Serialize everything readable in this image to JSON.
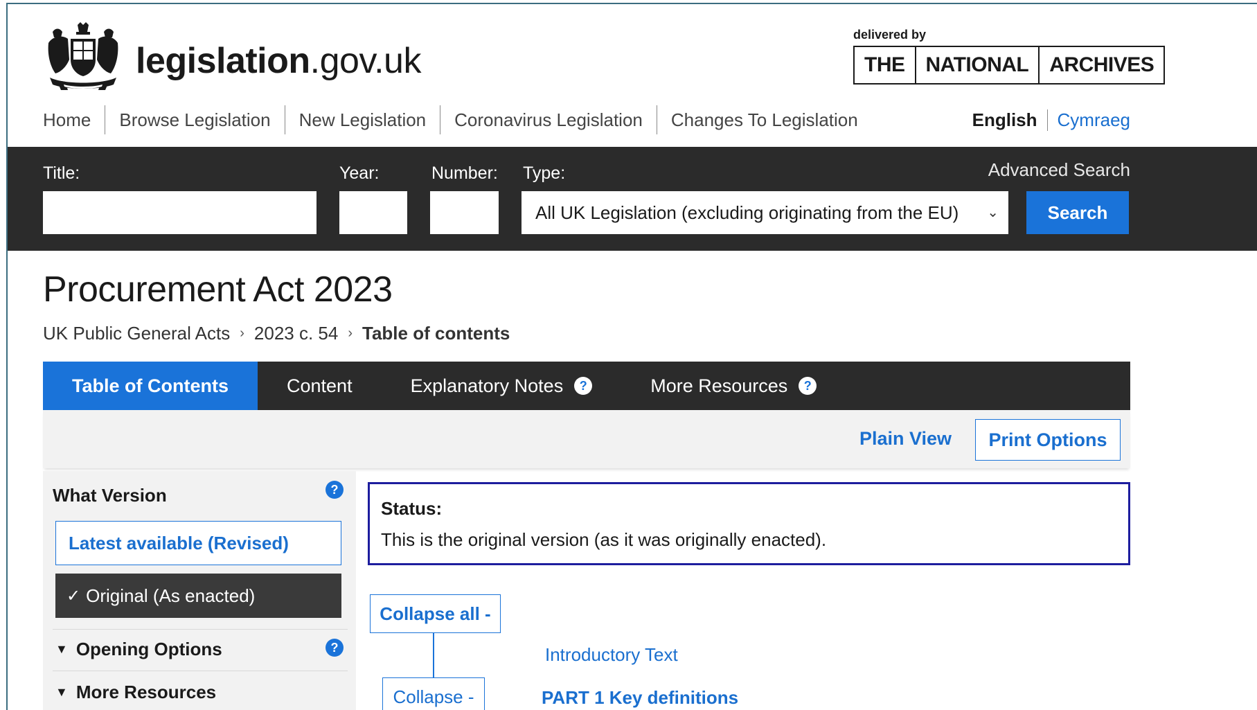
{
  "header": {
    "logo_bold": "legislation",
    "logo_light": ".gov.uk",
    "delivered_by": "delivered by",
    "tna": [
      "THE",
      "NATIONAL",
      "ARCHIVES"
    ]
  },
  "nav": {
    "items": [
      "Home",
      "Browse Legislation",
      "New Legislation",
      "Coronavirus Legislation",
      "Changes To Legislation"
    ],
    "lang_en": "English",
    "lang_cy": "Cymraeg"
  },
  "search": {
    "title_label": "Title:",
    "year_label": "Year:",
    "number_label": "Number:",
    "type_label": "Type:",
    "advanced": "Advanced Search",
    "type_value": "All UK Legislation (excluding originating from the EU)",
    "button": "Search"
  },
  "page": {
    "title": "Procurement Act 2023",
    "breadcrumb": [
      "UK Public General Acts",
      "2023 c. 54",
      "Table of contents"
    ]
  },
  "tabs": [
    {
      "label": "Table of Contents",
      "active": true,
      "help": false
    },
    {
      "label": "Content",
      "active": false,
      "help": false
    },
    {
      "label": "Explanatory Notes",
      "active": false,
      "help": true
    },
    {
      "label": "More Resources",
      "active": false,
      "help": true
    }
  ],
  "toolbar": {
    "plain_view": "Plain View",
    "print_options": "Print Options"
  },
  "sidebar": {
    "heading": "What Version",
    "latest": "Latest available (Revised)",
    "original": "Original (As enacted)",
    "opening_options": "Opening Options",
    "more_resources": "More Resources"
  },
  "status": {
    "label": "Status:",
    "text": "This is the original version (as it was originally enacted)."
  },
  "toc": {
    "collapse_all": "Collapse all -",
    "collapse": "Collapse -",
    "intro": "Introductory Text",
    "part1": "PART 1 Key definitions"
  },
  "colors": {
    "accent": "#1a73d9",
    "dark_bar": "#2b2b2b",
    "status_border": "#1d1d9e"
  },
  "icons": {
    "crest": "royal-coat-of-arms-icon",
    "help": "question-circle-icon",
    "check": "check-icon",
    "triangle": "triangle-down-icon",
    "chevron": "chevron-down-icon"
  }
}
